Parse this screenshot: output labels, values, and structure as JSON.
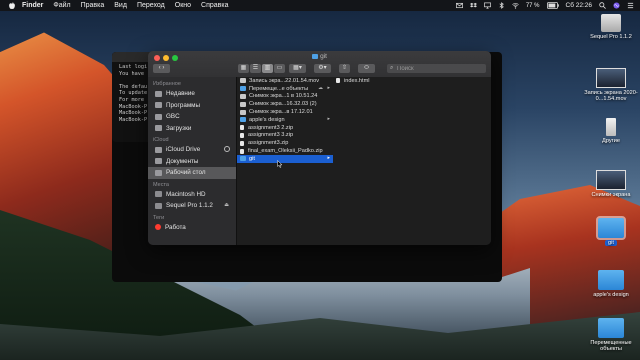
{
  "menubar": {
    "app": "Finder",
    "items": [
      "Файл",
      "Правка",
      "Вид",
      "Переход",
      "Окно",
      "Справка"
    ],
    "battery": "77 %",
    "clock": "Сб 22:26"
  },
  "terminal": {
    "lines": [
      "Last logi",
      "You have",
      "",
      "The defau",
      "To update",
      "For more",
      "MacBook-P",
      "MacBook-P",
      "MacBook-P"
    ]
  },
  "finder": {
    "title": "git",
    "search_placeholder": "Поиск",
    "sidebar": {
      "favorites_header": "Избранное",
      "favorites": [
        "Недавние",
        "Программы",
        "GBC",
        "Загрузки"
      ],
      "icloud_header": "iCloud",
      "icloud": [
        "iCloud Drive",
        "Документы",
        "Рабочий стол"
      ],
      "places_header": "Места",
      "places": [
        "Macintosh HD",
        "Sequel Pro 1.1.2"
      ],
      "tags_header": "Теги",
      "tags": [
        "Работа"
      ]
    },
    "column1": [
      {
        "name": "Запись экра...22.01.54.mov",
        "kind": "image",
        "arrow": false
      },
      {
        "name": "Перемеще...е объекты",
        "kind": "folder",
        "arrow": true,
        "cloud": true
      },
      {
        "name": "Снимок экра...1 в 10.51.24",
        "kind": "image",
        "arrow": false
      },
      {
        "name": "Снимок экра...16.32.03 (2)",
        "kind": "image",
        "arrow": false
      },
      {
        "name": "Снимок экра...в 17.12.01",
        "kind": "image",
        "arrow": false
      },
      {
        "name": "apple's design",
        "kind": "folder",
        "arrow": true
      },
      {
        "name": "assignment3 2.zip",
        "kind": "doc",
        "arrow": false
      },
      {
        "name": "assignment3 3.zip",
        "kind": "doc",
        "arrow": false
      },
      {
        "name": "assignment3.zip",
        "kind": "doc",
        "arrow": false
      },
      {
        "name": "final_exam_Oleksii_Padko.zip",
        "kind": "doc",
        "arrow": false
      },
      {
        "name": "git",
        "kind": "folder",
        "arrow": true,
        "selected": true
      }
    ],
    "column2": [
      {
        "name": "index.html",
        "kind": "doc"
      }
    ]
  },
  "desktop": {
    "icons": [
      {
        "label": "Sequel Pro 1.1.2",
        "kind": "drive"
      },
      {
        "label": "Запись экрана 2020-0...1.54.mov",
        "kind": "thumb"
      },
      {
        "label": "Другие",
        "kind": "usb"
      },
      {
        "label": "Снимки экрана",
        "kind": "thumb"
      },
      {
        "label": "git",
        "kind": "folder"
      },
      {
        "label": "apple's design",
        "kind": "folder"
      },
      {
        "label": "Перемещенные объекты",
        "kind": "folder"
      }
    ]
  },
  "colors": {
    "selection": "#1b5fd1",
    "folder": "#4ea1e6",
    "tag_red": "#ff3b30"
  }
}
